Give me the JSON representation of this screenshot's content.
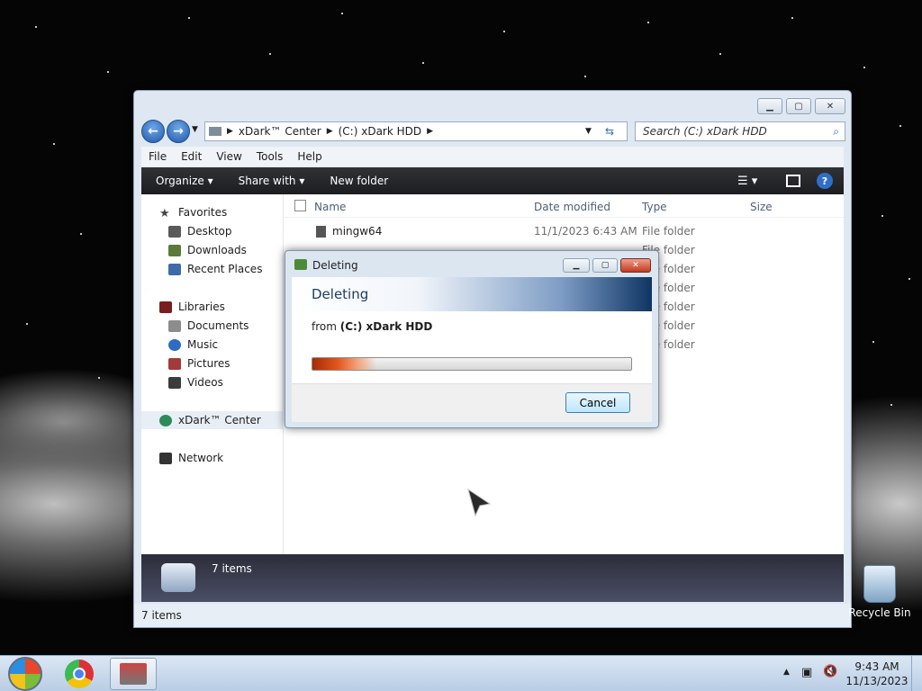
{
  "desktop": {
    "recycle_bin_label": "Recycle Bin"
  },
  "explorer": {
    "address": {
      "segments": [
        "xDark™ Center",
        "(C:) xDark HDD"
      ]
    },
    "search_placeholder": "Search (C:) xDark HDD",
    "menu": [
      "File",
      "Edit",
      "View",
      "Tools",
      "Help"
    ],
    "commands": {
      "organize": "Organize",
      "share_with": "Share with",
      "new_folder": "New folder"
    },
    "nav": {
      "favorites": "Favorites",
      "desktop": "Desktop",
      "downloads": "Downloads",
      "recent_places": "Recent Places",
      "libraries": "Libraries",
      "documents": "Documents",
      "music": "Music",
      "pictures": "Pictures",
      "videos": "Videos",
      "computer": "xDark™ Center",
      "network": "Network"
    },
    "columns": {
      "name": "Name",
      "date_modified": "Date modified",
      "type": "Type",
      "size": "Size"
    },
    "rows": [
      {
        "name": "mingw64",
        "date": "11/1/2023 6:43 AM",
        "type": "File folder"
      },
      {
        "type": "File folder"
      },
      {
        "type": "File folder"
      },
      {
        "type": "File folder"
      },
      {
        "type": "File folder"
      },
      {
        "type": "File folder"
      },
      {
        "type": "File folder"
      }
    ],
    "details_count": "7 items",
    "status_count": "7 items"
  },
  "dialog": {
    "title": "Deleting",
    "heading": "Deleting",
    "from_label": "from",
    "from_value": "(C:) xDark HDD",
    "progress_fraction": 0.2,
    "cancel_label": "Cancel"
  },
  "taskbar": {
    "time": "9:43 AM",
    "date": "11/13/2023"
  },
  "colors": {
    "accent_blue": "#1f5aaa",
    "progress_orange": "#e3571d",
    "cmdbar_dark": "#1c1d20"
  }
}
